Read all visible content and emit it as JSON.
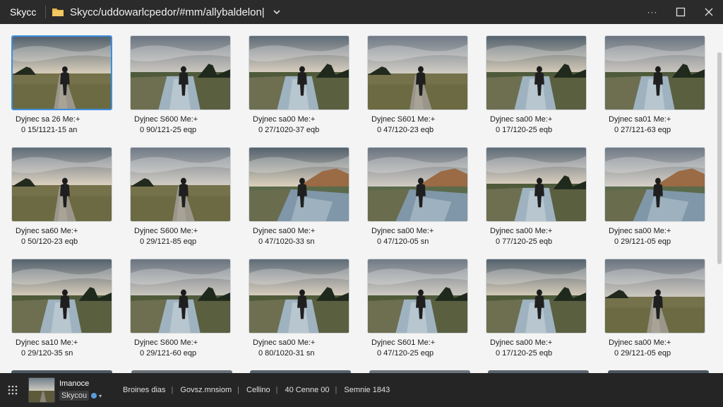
{
  "window": {
    "title": "Skycc",
    "path": "Skycc/uddowarlcpedor/#mm/allybaldelon|"
  },
  "colors": {
    "titlebar_bg": "#2b2b2b",
    "selection_border": "#3d8fe0",
    "folder_yellow": "#e8b84a",
    "status_bg": "#252525"
  },
  "icons": {
    "folder": "folder-icon",
    "chevron": "chevron-down-icon",
    "more": "more-icon",
    "maximize": "maximize-icon",
    "close": "close-icon",
    "grid": "grid-view-icon"
  },
  "window_controls": {
    "more": "···",
    "maximize": "☐",
    "close": "✕"
  },
  "photos": [
    {
      "name": "Dyjnec sa 26 Me:+",
      "meta": "0 15/1121-15 an",
      "selected": true,
      "scene": "path"
    },
    {
      "name": "Dyjnec S600 Me:+",
      "meta": "0 90/121-25 eqp",
      "selected": false,
      "scene": "water"
    },
    {
      "name": "Dyjnec sa00 Me:+",
      "meta": "0 27/1020-37 eqb",
      "selected": false,
      "scene": "water"
    },
    {
      "name": "Dyjnec S601 Me:+",
      "meta": "0 47/120-23 eqb",
      "selected": false,
      "scene": "path"
    },
    {
      "name": "Dyjnec sa00 Me:+",
      "meta": "0 17/120-25 eqb",
      "selected": false,
      "scene": "water"
    },
    {
      "name": "Dyjnec sa01 Me:+",
      "meta": "0 27/121-63 eqp",
      "selected": false,
      "scene": "water"
    },
    {
      "name": "Dyjnec sa60 Me:+",
      "meta": "0 50/120-23 eqb",
      "selected": false,
      "scene": "path"
    },
    {
      "name": "Dyjnec S600 Me:+",
      "meta": "0 29/121-85 eqp",
      "selected": false,
      "scene": "path"
    },
    {
      "name": "Dyjnec sa00 Me:+",
      "meta": "0 47/1020-33 sn",
      "selected": false,
      "scene": "mountain"
    },
    {
      "name": "Dyjnec sa00 Me:+",
      "meta": "0 47/120-05 sn",
      "selected": false,
      "scene": "mountain"
    },
    {
      "name": "Dyjnec sa00 Me:+",
      "meta": "0 77/120-25 eqb",
      "selected": false,
      "scene": "water"
    },
    {
      "name": "Dyjnec sa00 Me:+",
      "meta": "0 29/121-05 eqp",
      "selected": false,
      "scene": "mountain"
    },
    {
      "name": "Dyjnec sa10 Me:+",
      "meta": "0 29/120-35 sn",
      "selected": false,
      "scene": "water"
    },
    {
      "name": "Dyjnec S600 Me:+",
      "meta": "0 29/121-60 eqp",
      "selected": false,
      "scene": "water"
    },
    {
      "name": "Dyjnec sa00 Me:+",
      "meta": "0 80/1020-31 sn",
      "selected": false,
      "scene": "water"
    },
    {
      "name": "Dyjnec S601 Me:+",
      "meta": "0 47/120-25 eqp",
      "selected": false,
      "scene": "water"
    },
    {
      "name": "Dyjnec sa00 Me:+",
      "meta": "0 17/120-25 eqb",
      "selected": false,
      "scene": "water"
    },
    {
      "name": "Dyjnec sa00 Me:+",
      "meta": "0 29/121-05 eqp",
      "selected": false,
      "scene": "path"
    }
  ],
  "status": {
    "selected_name": "Imanoce",
    "tag": "Skycou",
    "items": [
      "Broines dias",
      "Govsz.mnsiom",
      "Cellino",
      "40 Cenne 00",
      "Semnie 1843"
    ],
    "separators": [
      "|",
      "|",
      "|",
      "|"
    ]
  }
}
